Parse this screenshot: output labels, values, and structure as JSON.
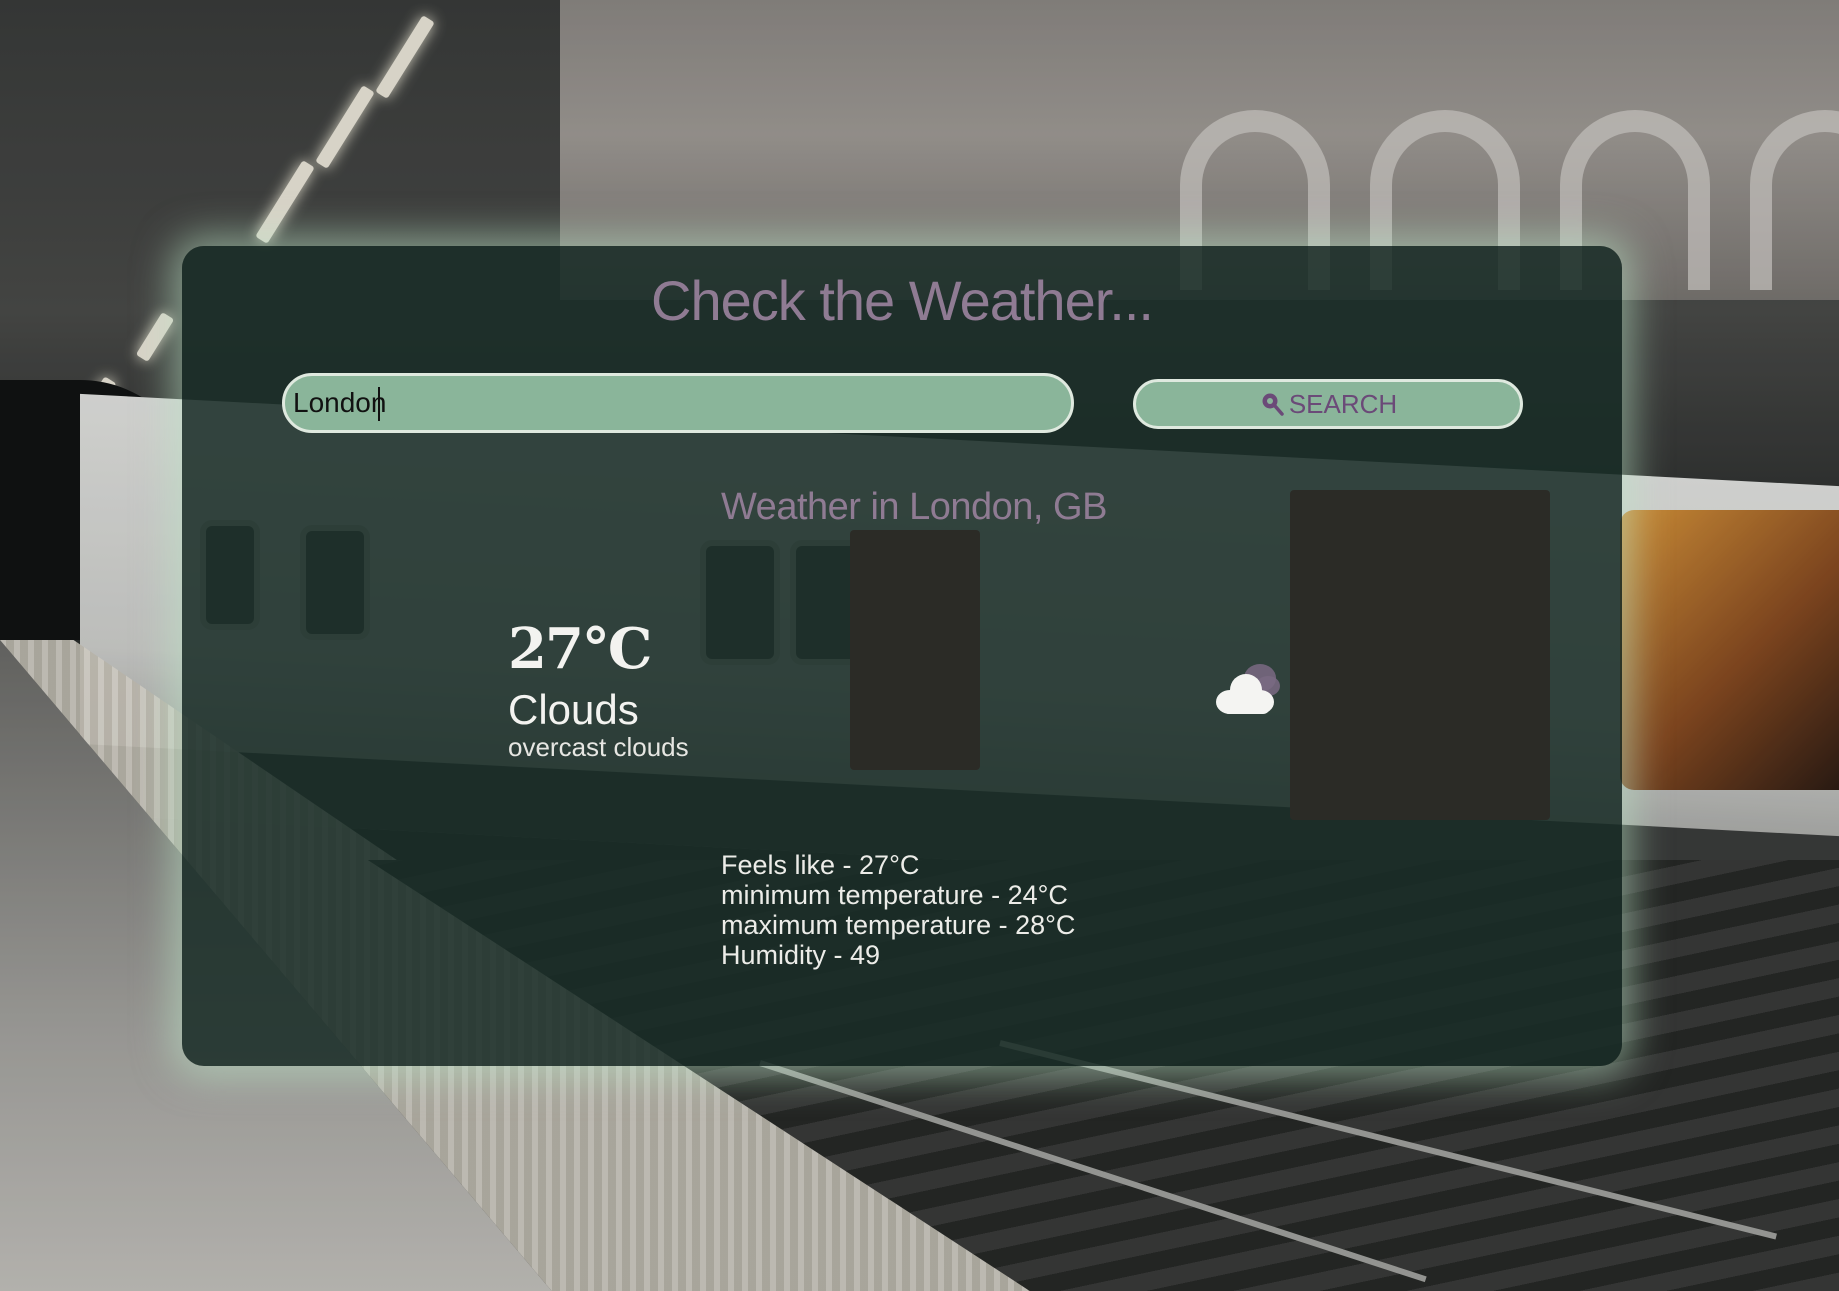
{
  "page": {
    "title": "Check the Weather..."
  },
  "search": {
    "value": "London",
    "button_label": "SEARCH",
    "button_icon": "search-location-icon"
  },
  "weather": {
    "location": "Weather in London, GB",
    "temperature": "27°C",
    "condition": "Clouds",
    "description": "overcast clouds",
    "icon": "cloud-icon",
    "details": {
      "feels_like": "Feels like - 27°C",
      "min_temp": "minimum temperature - 24°C",
      "max_temp": "maximum temperature - 28°C",
      "humidity": "Humidity - 49"
    }
  },
  "colors": {
    "card_bg": "#182c26",
    "accent_text": "#8f7b93",
    "input_bg": "#8ab59a",
    "button_text": "#6b4a78",
    "glow": "#bee8c8"
  }
}
